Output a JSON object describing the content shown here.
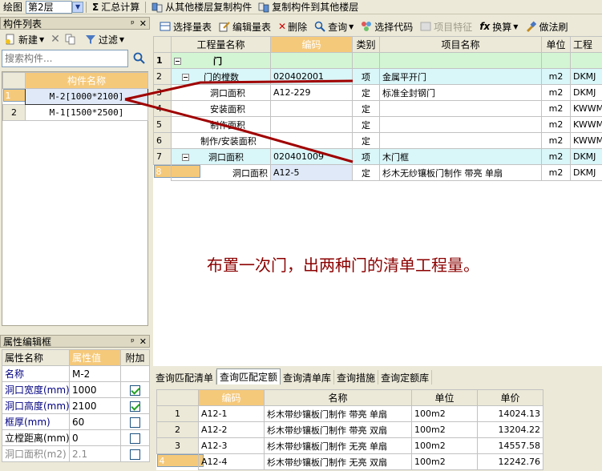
{
  "topbar": {
    "draw_label": "绘图",
    "floor_select": "第2层",
    "calc_summary": "汇总计算",
    "copy_from_floor": "从其他楼层复制构件",
    "copy_to_floor": "复制构件到其他楼层"
  },
  "component_list": {
    "title": "构件列表",
    "new_label": "新建",
    "filter_label": "过滤",
    "search_placeholder": "搜索构件...",
    "column_header": "构件名称",
    "rows": [
      {
        "num": "1",
        "name": "M-2[1000*2100]"
      },
      {
        "num": "2",
        "name": "M-1[1500*2500]"
      }
    ]
  },
  "main_toolbar": {
    "select_table": "选择量表",
    "edit_table": "编辑量表",
    "delete": "删除",
    "query": "查询",
    "select_code": "选择代码",
    "item_feature": "项目特征",
    "convert": "换算",
    "practice_brush": "做法刷"
  },
  "main_table": {
    "headers": {
      "quantity_name": "工程量名称",
      "code": "编码",
      "category": "类别",
      "item_name": "项目名称",
      "unit": "单位",
      "expr": "工程"
    },
    "rows": [
      {
        "num": "1",
        "qname": "门",
        "code": "",
        "cat": "",
        "iname": "",
        "unit": "",
        "expr": ""
      },
      {
        "num": "2",
        "qname": "门的樘数",
        "code": "020402001",
        "cat": "项",
        "iname": "金属平开门",
        "unit": "m2",
        "expr": "DKMJ"
      },
      {
        "num": "3",
        "qname": "洞口面积",
        "code": "A12-229",
        "cat": "定",
        "iname": "标准全封钢门",
        "unit": "m2",
        "expr": "DKMJ"
      },
      {
        "num": "4",
        "qname": "安装面积",
        "code": "",
        "cat": "定",
        "iname": "",
        "unit": "m2",
        "expr": "KWWMJ"
      },
      {
        "num": "5",
        "qname": "制作面积",
        "code": "",
        "cat": "定",
        "iname": "",
        "unit": "m2",
        "expr": "KWWMJ"
      },
      {
        "num": "6",
        "qname": "制作/安装面积",
        "code": "",
        "cat": "定",
        "iname": "",
        "unit": "m2",
        "expr": "KWWMJ"
      },
      {
        "num": "7",
        "qname": "洞口面积",
        "code": "020401009",
        "cat": "项",
        "iname": "木门框",
        "unit": "m2",
        "expr": "DKMJ"
      },
      {
        "num": "8",
        "qname": "洞口面积",
        "code": "A12-5",
        "cat": "定",
        "iname": "杉木无纱镶板门制作 带亮 单扇",
        "unit": "m2",
        "expr": "DKMJ"
      }
    ]
  },
  "annotation": "布置一次门，出两种门的清单工程量。",
  "property_panel": {
    "title": "属性编辑框",
    "headers": {
      "name": "属性名称",
      "value": "属性值",
      "extra": "附加"
    },
    "rows": [
      {
        "name": "名称",
        "value": "M-2",
        "checkbox": null
      },
      {
        "name": "洞口宽度(mm)",
        "value": "1000",
        "checkbox": true
      },
      {
        "name": "洞口高度(mm)",
        "value": "2100",
        "checkbox": true
      },
      {
        "name": "框厚(mm)",
        "value": "60",
        "checkbox": false
      },
      {
        "name": "立樘距离(mm)",
        "value": "0",
        "checkbox": false
      },
      {
        "name": "洞口面积(m2)",
        "value": "2.1",
        "checkbox": false
      }
    ]
  },
  "bottom_tabs": [
    "查询匹配清单",
    "查询匹配定额",
    "查询清单库",
    "查询措施",
    "查询定额库"
  ],
  "bottom_table": {
    "headers": {
      "code": "编码",
      "name": "名称",
      "unit": "单位",
      "price": "单价"
    },
    "rows": [
      {
        "num": "1",
        "code": "A12-1",
        "name": "杉木带纱镶板门制作 带亮 单扇",
        "unit": "100m2",
        "price": "14024.13"
      },
      {
        "num": "2",
        "code": "A12-2",
        "name": "杉木带纱镶板门制作 带亮 双扇",
        "unit": "100m2",
        "price": "13204.22"
      },
      {
        "num": "3",
        "code": "A12-3",
        "name": "杉木带纱镶板门制作 无亮 单扇",
        "unit": "100m2",
        "price": "14557.58"
      },
      {
        "num": "4",
        "code": "A12-4",
        "name": "杉木带纱镶板门制作 无亮 双扇",
        "unit": "100m2",
        "price": "12242.76"
      }
    ]
  },
  "colors": {
    "highlight_header": "#f5c97a",
    "group_row": "#d3f5d3",
    "list_row": "#d9f6f9",
    "annotation": "#8b0000",
    "arrow": "#a00000"
  }
}
